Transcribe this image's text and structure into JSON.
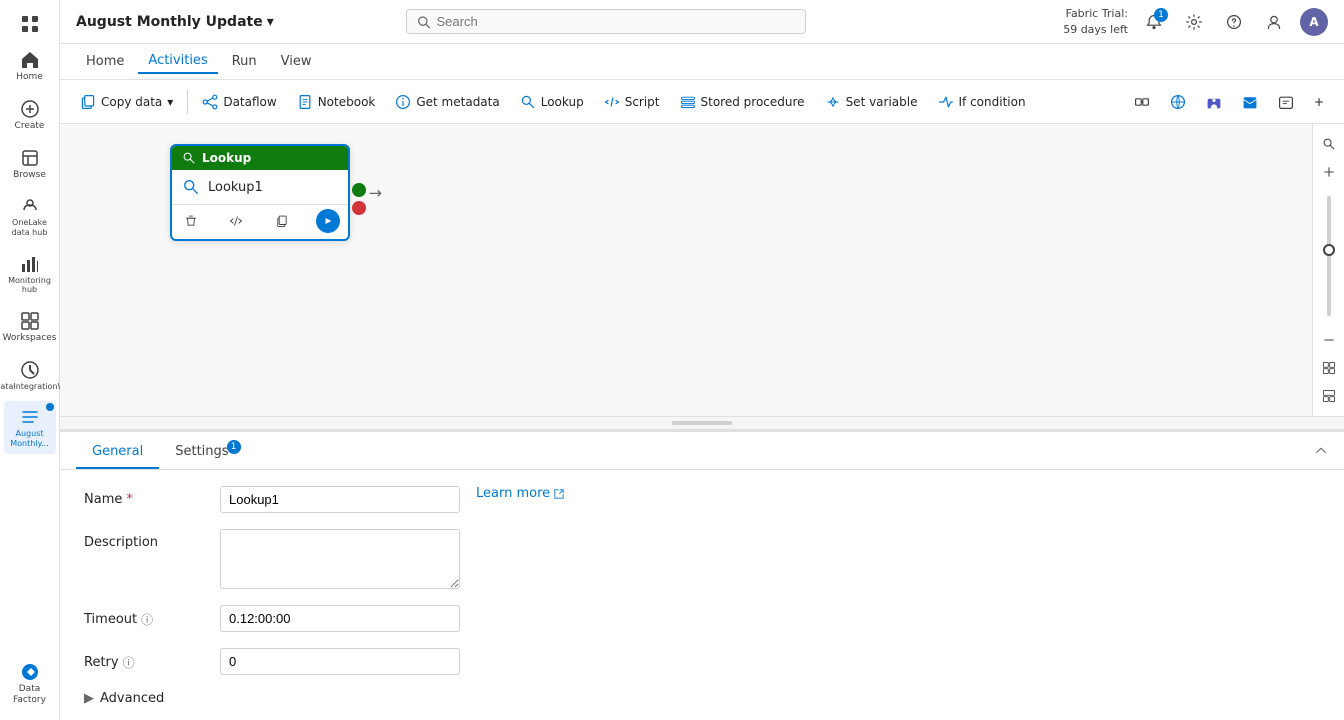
{
  "app": {
    "title": "August Monthly Update",
    "chevron": "▾"
  },
  "search": {
    "placeholder": "Search"
  },
  "topRight": {
    "trial_line1": "Fabric Trial:",
    "trial_line2": "59 days left",
    "notif_count": "1"
  },
  "menu": {
    "items": [
      "Home",
      "Activities",
      "Run",
      "View"
    ],
    "active": "Activities"
  },
  "toolbar": {
    "buttons": [
      {
        "id": "copy-data",
        "label": "Copy data",
        "hasDropdown": true
      },
      {
        "id": "dataflow",
        "label": "Dataflow",
        "hasDropdown": false
      },
      {
        "id": "notebook",
        "label": "Notebook",
        "hasDropdown": false
      },
      {
        "id": "get-metadata",
        "label": "Get metadata",
        "hasDropdown": false
      },
      {
        "id": "lookup",
        "label": "Lookup",
        "hasDropdown": false
      },
      {
        "id": "script",
        "label": "Script",
        "hasDropdown": false
      },
      {
        "id": "stored-procedure",
        "label": "Stored procedure",
        "hasDropdown": false
      },
      {
        "id": "set-variable",
        "label": "Set variable",
        "hasDropdown": false
      },
      {
        "id": "if-condition",
        "label": "If condition",
        "hasDropdown": false
      }
    ],
    "more_label": "+"
  },
  "node": {
    "type": "Lookup",
    "name": "Lookup1"
  },
  "sidebar": {
    "items": [
      {
        "id": "home",
        "label": "Home"
      },
      {
        "id": "create",
        "label": "Create"
      },
      {
        "id": "browse",
        "label": "Browse"
      },
      {
        "id": "onelake",
        "label": "OneLake data hub"
      },
      {
        "id": "monitoring",
        "label": "Monitoring hub"
      },
      {
        "id": "workspaces",
        "label": "Workspaces"
      },
      {
        "id": "mydata",
        "label": "myDataIntegrationWo..."
      },
      {
        "id": "august",
        "label": "August Monthly..."
      }
    ]
  },
  "bottomPanel": {
    "tabs": [
      {
        "id": "general",
        "label": "General",
        "badge": null
      },
      {
        "id": "settings",
        "label": "Settings",
        "badge": "1"
      }
    ],
    "active": "general",
    "form": {
      "name_label": "Name",
      "name_value": "Lookup1",
      "description_label": "Description",
      "description_value": "",
      "timeout_label": "Timeout",
      "timeout_value": "0.12:00:00",
      "retry_label": "Retry",
      "retry_value": "0",
      "advanced_label": "Advanced",
      "learn_more_label": "Learn more"
    }
  },
  "bottomBar": {
    "label": "Data Factory"
  }
}
